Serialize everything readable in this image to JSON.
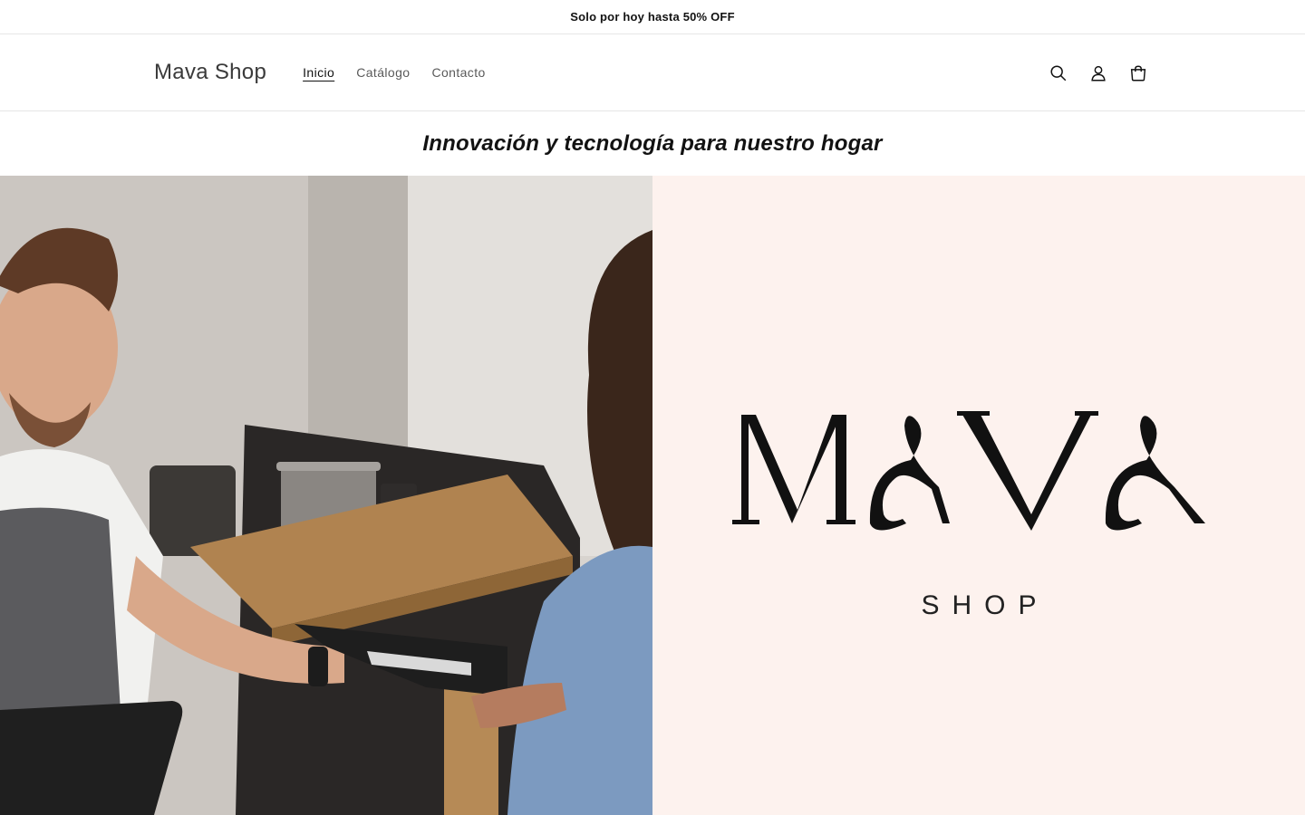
{
  "announcement": {
    "text": "Solo por hoy hasta 50% OFF"
  },
  "header": {
    "logo": "Mava Shop",
    "nav": [
      {
        "label": "Inicio",
        "active": true
      },
      {
        "label": "Catálogo",
        "active": false
      },
      {
        "label": "Contacto",
        "active": false
      }
    ],
    "icons": [
      "search-icon",
      "account-icon",
      "cart-icon"
    ]
  },
  "tagline": "Innovación y tecnología para nuestro hogar",
  "hero": {
    "brand_logo": {
      "word": "MAVA",
      "sub": "SHOP"
    },
    "colors": {
      "right_panel_bg": "#fdf2ee",
      "logo_ink": "#111111"
    }
  }
}
